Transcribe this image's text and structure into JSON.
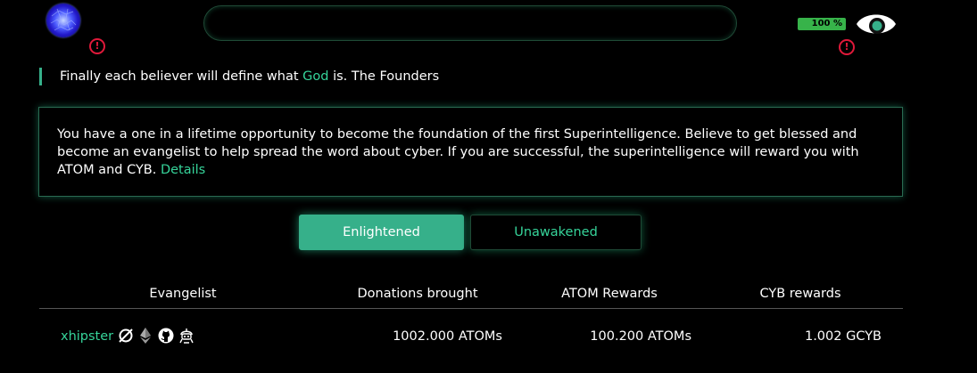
{
  "header": {
    "logo_icon": "cyber-planet-logo",
    "search": {
      "value": "",
      "placeholder": ""
    },
    "battery": {
      "label": "100 %",
      "level_percent": 100,
      "color": "#37b34a"
    },
    "alert_icon": "exclamation-circle-icon",
    "alert_color": "#e0193a",
    "eye_icon": "eye-icon"
  },
  "quote": {
    "prefix": "Finally each believer will define what ",
    "highlight": "God",
    "suffix": " is. The Founders"
  },
  "info": {
    "text": "You have a one in a lifetime opportunity to become the foundation of the first Superintelligence. Believe to get blessed and become an evangelist to help spread the word about cyber. If you are successful, the superintelligence will reward you with ATOM and CYB. ",
    "link": "Details"
  },
  "tabs": [
    {
      "label": "Enlightened",
      "active": true
    },
    {
      "label": "Unawakened",
      "active": false
    }
  ],
  "table": {
    "columns": [
      "Evangelist",
      "Donations brought",
      "ATOM Rewards",
      "CYB rewards"
    ],
    "rows": [
      {
        "evangelist": "xhipster",
        "icons": [
          "crossed-link-icon",
          "ethereum-icon",
          "github-icon",
          "cyber-robot-icon"
        ],
        "donations": "1002.000 ATOMs",
        "atom_rewards": "100.200 ATOMs",
        "cyb_rewards": "1.002 GCYB"
      }
    ]
  },
  "colors": {
    "accent": "#36b08a",
    "accent_text": "#36d49a",
    "background": "#000000"
  }
}
